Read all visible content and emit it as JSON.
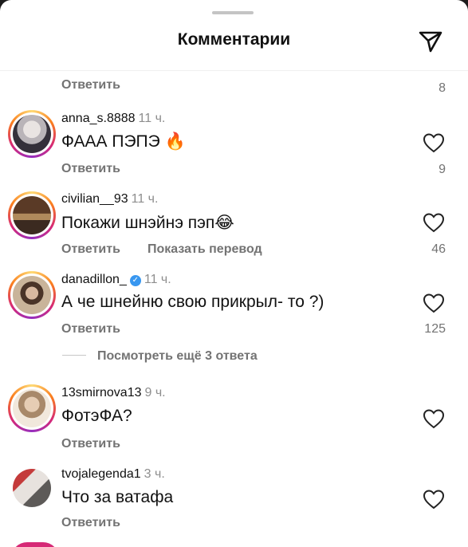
{
  "header": {
    "title": "Комментарии"
  },
  "top_row": {
    "reply_label": "Ответить",
    "likes": "8"
  },
  "comments": [
    {
      "username": "anna_s.8888",
      "time": "11 ч.",
      "text": "ФААА ПЭПЭ 🔥",
      "reply_label": "Ответить",
      "likes": "9",
      "verified": false
    },
    {
      "username": "civilian__93",
      "time": "11 ч.",
      "text": "Покажи шнэйнэ пэп😂",
      "reply_label": "Ответить",
      "translate_label": "Показать перевод",
      "likes": "46",
      "verified": false
    },
    {
      "username": "danadillon_",
      "time": "11 ч.",
      "text": "А че шнейню свою прикрыл-  то ?)",
      "reply_label": "Ответить",
      "likes": "125",
      "verified": true
    },
    {
      "username": "13smirnova13",
      "time": "9 ч.",
      "text": "ФотэФА?",
      "reply_label": "Ответить",
      "likes": "",
      "verified": false
    },
    {
      "username": "tvojalegenda1",
      "time": "3 ч.",
      "text": "Что за ватафа",
      "reply_label": "Ответить",
      "likes": "",
      "verified": false
    }
  ],
  "more_replies_label": "Посмотреть ещё 3 ответа",
  "icons": {
    "share": "send-icon",
    "like": "heart-icon",
    "verified": "verified-badge-icon"
  },
  "colors": {
    "text": "#111111",
    "secondary": "#737373",
    "verified": "#3897f0"
  }
}
